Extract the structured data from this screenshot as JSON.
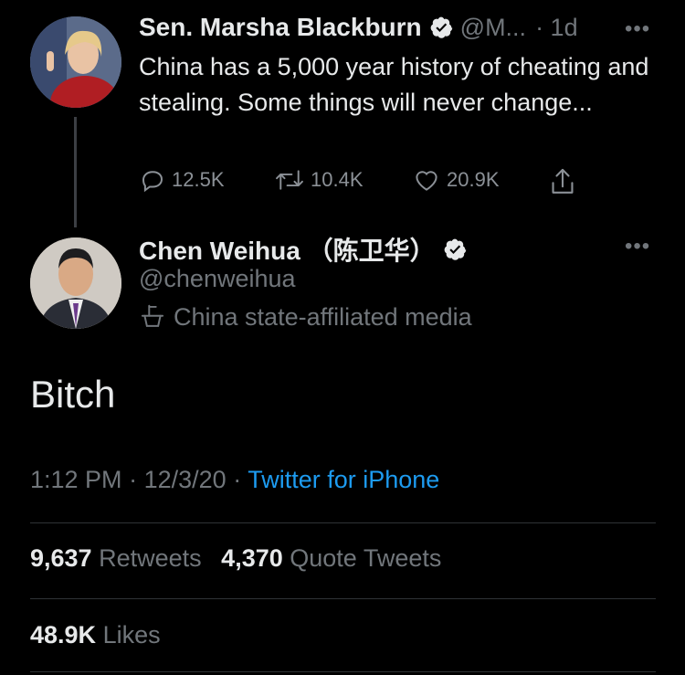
{
  "tweet1": {
    "name": "Sen. Marsha Blackburn",
    "handle": "@M...",
    "time": "· 1d",
    "more": "•••",
    "text": "China has a 5,000 year history of cheating and stealing. Some things will never change...",
    "replies": "12.5K",
    "retweets": "10.4K",
    "likes": "20.9K"
  },
  "tweet2": {
    "name": "Chen Weihua （陈卫华）",
    "handle": "@chenweihua",
    "label": "China state-affiliated media",
    "more": "•••",
    "text": "Bitch",
    "time": "1:12 PM",
    "date": "12/3/20",
    "source": "Twitter for iPhone",
    "retweets_count": "9,637",
    "retweets_label": "Retweets",
    "quotes_count": "4,370",
    "quotes_label": "Quote Tweets",
    "likes_count": "48.9K",
    "likes_label": "Likes"
  },
  "colors": {
    "accent": "#1d9bf0",
    "muted": "#71767b",
    "background": "#000000"
  },
  "icons": [
    "verified-icon",
    "reply-icon",
    "retweet-icon",
    "like-icon",
    "share-icon",
    "state-media-icon",
    "more-icon"
  ]
}
